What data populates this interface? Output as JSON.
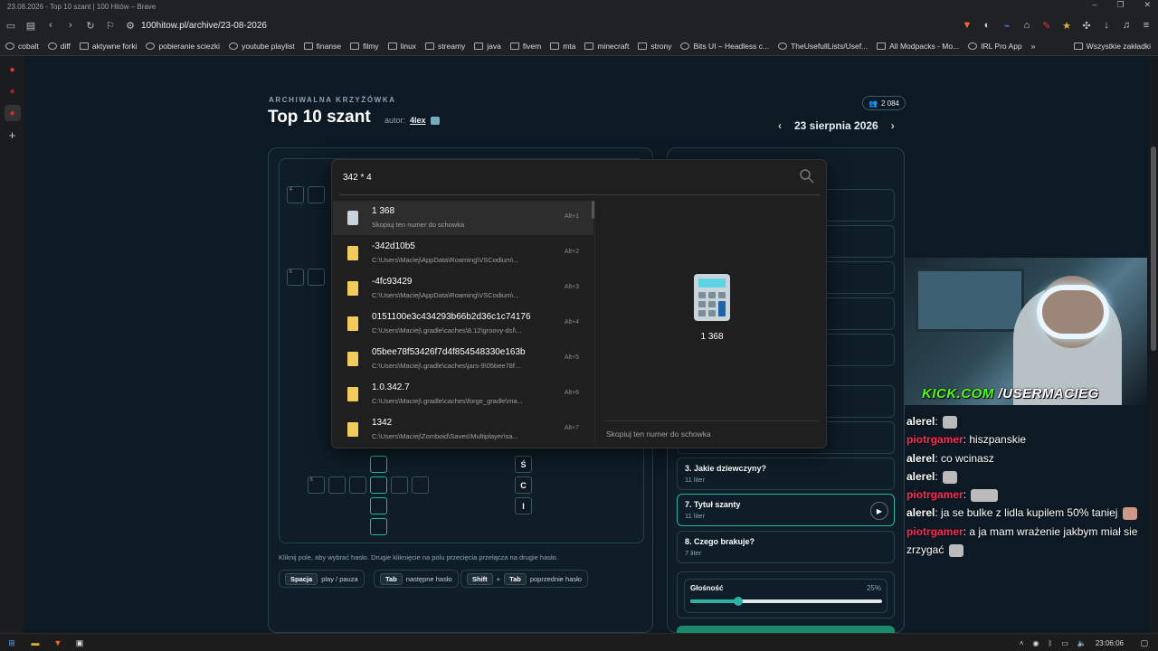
{
  "window": {
    "title": "23.08.2026 - Top 10 szant | 100 Hitów – Brave"
  },
  "browser": {
    "url": "100hitow.pl/archive/23-08-2026"
  },
  "bookmarks": [
    "cobalt",
    "diff",
    "aktywne forki",
    "pobieranie sciezki",
    "youtube playlist",
    "finanse",
    "filmy",
    "linux",
    "streamy",
    "java",
    "fivem",
    "mta",
    "minecraft",
    "strony",
    "Bits UI – Headless c...",
    "TheUsefullLists/Usef...",
    "All Modpacks - Mo...",
    "IRL Pro App"
  ],
  "bookmarks_overflow": "»",
  "bookmarks_all": "Wszystkie zakładki",
  "page": {
    "kicker": "ARCHIWALNA KRZYŻÓWKA",
    "title": "Top 10 szant",
    "author_prefix": "autor:",
    "author_name": "4lex",
    "players": "2 084",
    "date": "23 sierpnia 2026",
    "hint": "Kliknij pole, aby wybrać hasło. Drugie kliknięcie na polu przecięcia przełącza na drugie hasło.",
    "shortcuts": [
      {
        "key": "Spacja",
        "label": "play / pauza"
      },
      {
        "key": "Tab",
        "label": "następne hasło"
      },
      {
        "key": "Shift",
        "plus": "+",
        "key2": "Tab",
        "label": "poprzednie hasło"
      }
    ]
  },
  "grid": {
    "numbers": [
      "4",
      "6",
      "5"
    ],
    "letters": [
      "Ś",
      "C",
      "I"
    ]
  },
  "clues": [
    {
      "q": "3. Jakie dziewczyny?",
      "len": "11 liter"
    },
    {
      "q": "7. Tytuł szanty",
      "len": "11 liter"
    },
    {
      "q": "8. Czego brakuje?",
      "len": "7 liter"
    }
  ],
  "volume": {
    "label": "Głośność",
    "value": "25%",
    "level": 0.25
  },
  "search": {
    "query": "342 * 4",
    "results": [
      {
        "title": "1 368",
        "sub": "Skopiuj ten numer do schowka",
        "shortcut": "Alt+1",
        "icon": "calculator-icon"
      },
      {
        "title": "-342d10b5",
        "sub": "C:\\Users\\Maciej\\AppData\\Roaming\\VSCodium\\...",
        "shortcut": "Alt+2",
        "icon": "folder-icon"
      },
      {
        "title": "-4fc93429",
        "sub": "C:\\Users\\Maciej\\AppData\\Roaming\\VSCodium\\...",
        "shortcut": "Alt+3",
        "icon": "folder-icon"
      },
      {
        "title": "0151100e3c434293b66b2d36c1c74176",
        "sub": "C:\\Users\\Maciej\\.gradle\\caches\\8.12\\groovy-dsl\\...",
        "shortcut": "Alt+4",
        "icon": "folder-icon"
      },
      {
        "title": "05bee78f53426f7d4f854548330e163b",
        "sub": "C:\\Users\\Maciej\\.gradle\\caches\\jars-9\\05bee78f...",
        "shortcut": "Alt+5",
        "icon": "folder-icon"
      },
      {
        "title": "1.0.342.7",
        "sub": "C:\\Users\\Maciej\\.gradle\\caches\\forge_gradle\\ma...",
        "shortcut": "Alt+6",
        "icon": "folder-icon"
      },
      {
        "title": "1342",
        "sub": "C:\\Users\\Maciej\\Zomboid\\Saves\\Multiplayer\\sa...",
        "shortcut": "Alt+7",
        "icon": "folder-icon"
      }
    ],
    "preview_value": "1 368",
    "preview_action": "Skopiuj ten numer do schowka"
  },
  "stream": {
    "brand_a": "KICK.COM",
    "brand_b": "/USERMACIEG",
    "chat": [
      {
        "user": "alerel",
        "color": "#ffffff",
        "text": ""
      },
      {
        "user": "piotrgamer",
        "color": "#ff2a55",
        "text": "hiszpanskie"
      },
      {
        "user": "alerel",
        "color": "#ffffff",
        "text": "co wcinasz"
      },
      {
        "user": "alerel",
        "color": "#ffffff",
        "text": ""
      },
      {
        "user": "piotrgamer",
        "color": "#ff2a55",
        "text": ""
      },
      {
        "user": "alerel",
        "color": "#ffffff",
        "text": "ja se bulke z lidla kupilem 50% taniej"
      },
      {
        "user": "piotrgamer",
        "color": "#ff2a55",
        "text": "a ja mam wrażenie jakbym miał sie zrzygać"
      }
    ]
  },
  "taskbar": {
    "time": "23:06:06"
  }
}
